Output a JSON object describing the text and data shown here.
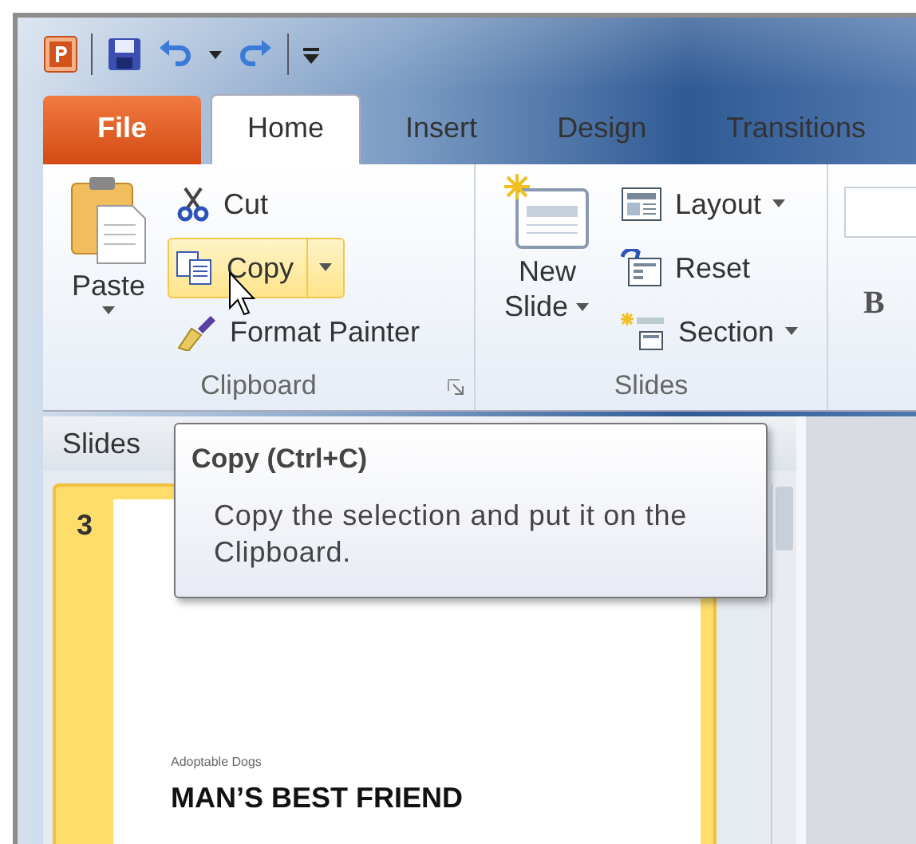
{
  "tabs": [
    {
      "label": "File",
      "kind": "file",
      "selected": false
    },
    {
      "label": "Home",
      "kind": "tab",
      "selected": true
    },
    {
      "label": "Insert",
      "kind": "tab",
      "selected": false
    },
    {
      "label": "Design",
      "kind": "tab",
      "selected": false
    },
    {
      "label": "Transitions",
      "kind": "tab",
      "selected": false
    }
  ],
  "ribbon": {
    "clipboard": {
      "label": "Clipboard",
      "paste": {
        "label": "Paste",
        "dropdown": true
      },
      "commands": [
        {
          "label": "Cut",
          "kind": "cut",
          "hovered": false,
          "dropdown": false
        },
        {
          "label": "Copy",
          "kind": "copy",
          "hovered": true,
          "dropdown": true
        },
        {
          "label": "Format Painter",
          "kind": "painter",
          "hovered": false,
          "dropdown": false
        }
      ]
    },
    "slides": {
      "label": "Slides",
      "new_slide": {
        "line1": "New",
        "line2": "Slide",
        "dropdown": true
      },
      "commands": [
        {
          "label": "Layout",
          "kind": "layout",
          "dropdown": true
        },
        {
          "label": "Reset",
          "kind": "reset",
          "dropdown": false
        },
        {
          "label": "Section",
          "kind": "section",
          "dropdown": true
        }
      ]
    },
    "font": {
      "bold": "B"
    }
  },
  "slides_pane": {
    "tab": "Slides",
    "thumbnails": [
      {
        "number": "3",
        "selected": true,
        "subtitle": "Adoptable Dogs",
        "title": "MAN’S BEST FRIEND"
      }
    ]
  },
  "tooltip": {
    "title": "Copy (Ctrl+C)",
    "body": "Copy the selection and put it on the Clipboard."
  }
}
